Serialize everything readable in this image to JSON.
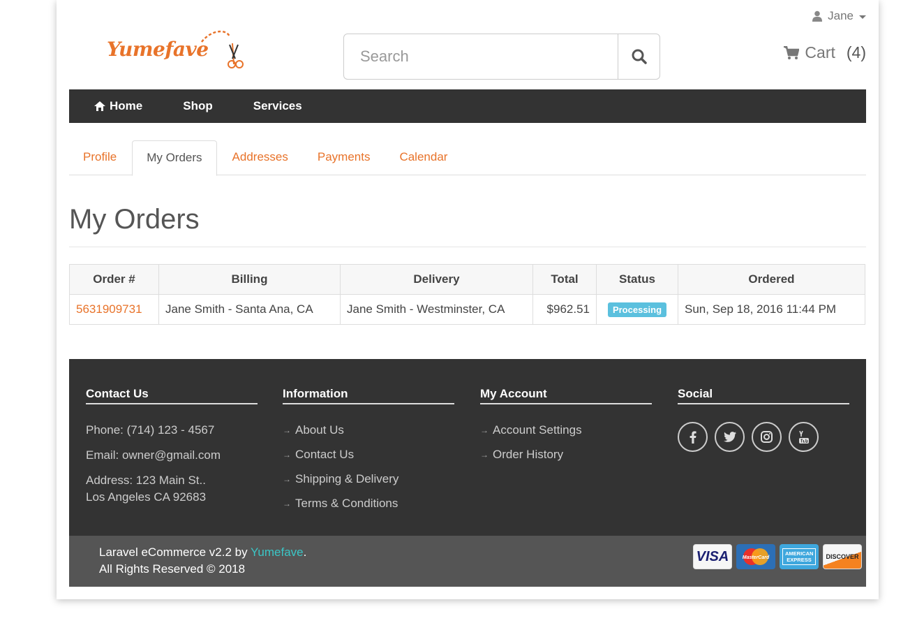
{
  "header": {
    "user_name": "Jane",
    "logo_text": "Yumefave",
    "search_placeholder": "Search",
    "cart_label": "Cart",
    "cart_count": "(4)"
  },
  "nav": {
    "items": [
      {
        "label": "Home",
        "icon": "home-icon"
      },
      {
        "label": "Shop"
      },
      {
        "label": "Services"
      }
    ]
  },
  "tabs": [
    {
      "label": "Profile",
      "active": false
    },
    {
      "label": "My Orders",
      "active": true
    },
    {
      "label": "Addresses",
      "active": false
    },
    {
      "label": "Payments",
      "active": false
    },
    {
      "label": "Calendar",
      "active": false
    }
  ],
  "page_title": "My Orders",
  "orders_table": {
    "columns": [
      "Order #",
      "Billing",
      "Delivery",
      "Total",
      "Status",
      "Ordered"
    ],
    "rows": [
      {
        "order_number": "5631909731",
        "billing": "Jane Smith - Santa Ana, CA",
        "delivery": "Jane Smith - Westminster, CA",
        "total": "$962.51",
        "status": "Processing",
        "ordered": "Sun, Sep 18, 2016 11:44 PM"
      }
    ]
  },
  "footer": {
    "contact": {
      "heading": "Contact Us",
      "phone": "Phone: (714) 123 - 4567",
      "email": "Email: owner@gmail.com",
      "address_line1": "Address: 123 Main St..",
      "address_line2": "Los Angeles CA 92683"
    },
    "information": {
      "heading": "Information",
      "links": [
        "About Us",
        "Contact Us",
        "Shipping & Delivery",
        "Terms & Conditions"
      ]
    },
    "account": {
      "heading": "My Account",
      "links": [
        "Account Settings",
        "Order History"
      ]
    },
    "social": {
      "heading": "Social",
      "icons": [
        "facebook-icon",
        "twitter-icon",
        "instagram-icon",
        "youtube-icon"
      ]
    },
    "copyright_prefix": "Laravel eCommerce v2.2 by ",
    "copyright_brand": "Yumefave",
    "copyright_suffix": ".",
    "rights": "All Rights Reserved © 2018",
    "payment_cards": [
      "VISA",
      "MasterCard",
      "AMERICAN EXPRESS",
      "DISCOVER"
    ]
  },
  "colors": {
    "accent": "#e8732a",
    "nav_bg": "#333333",
    "badge": "#5bc0de",
    "brand_link": "#3bc6c6"
  }
}
